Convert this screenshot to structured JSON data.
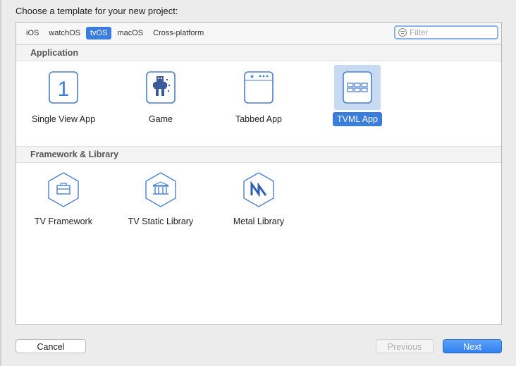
{
  "dialog": {
    "prompt": "Choose a template for your new project:"
  },
  "platform_tabs": [
    {
      "label": "iOS",
      "selected": false
    },
    {
      "label": "watchOS",
      "selected": false
    },
    {
      "label": "tvOS",
      "selected": true
    },
    {
      "label": "macOS",
      "selected": false
    },
    {
      "label": "Cross-platform",
      "selected": false
    }
  ],
  "filter": {
    "placeholder": "Filter",
    "value": ""
  },
  "sections": [
    {
      "title": "Application",
      "templates": [
        {
          "label": "Single View App",
          "icon": "single-view-icon",
          "selected": false
        },
        {
          "label": "Game",
          "icon": "game-icon",
          "selected": false
        },
        {
          "label": "Tabbed App",
          "icon": "tabbed-icon",
          "selected": false
        },
        {
          "label": "TVML App",
          "icon": "tvml-icon",
          "selected": true
        }
      ]
    },
    {
      "title": "Framework & Library",
      "templates": [
        {
          "label": "TV Framework",
          "icon": "framework-icon",
          "selected": false
        },
        {
          "label": "TV Static Library",
          "icon": "static-library-icon",
          "selected": false
        },
        {
          "label": "Metal Library",
          "icon": "metal-library-icon",
          "selected": false
        }
      ]
    }
  ],
  "buttons": {
    "cancel": "Cancel",
    "previous": "Previous",
    "next": "Next"
  },
  "colors": {
    "accent": "#3b7ddd",
    "icon_stroke": "#4a7fd0"
  }
}
